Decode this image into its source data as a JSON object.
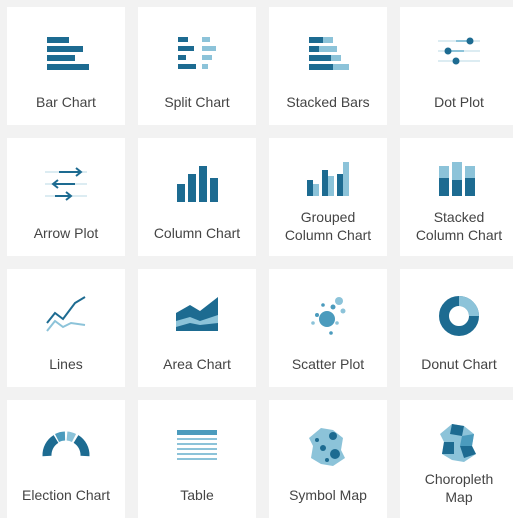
{
  "colors": {
    "primary": "#1d6b91",
    "light": "#8cc3d9",
    "mid": "#4b9bbd",
    "page": "#f2f2f2",
    "card": "#ffffff",
    "text": "#444444"
  },
  "tiles": [
    {
      "label": "Bar Chart",
      "icon": "bar-chart-icon"
    },
    {
      "label": "Split Chart",
      "icon": "split-chart-icon"
    },
    {
      "label": "Stacked Bars",
      "icon": "stacked-bars-icon"
    },
    {
      "label": "Dot Plot",
      "icon": "dot-plot-icon"
    },
    {
      "label": "Arrow Plot",
      "icon": "arrow-plot-icon"
    },
    {
      "label": "Column Chart",
      "icon": "column-chart-icon"
    },
    {
      "label": "Grouped\nColumn Chart",
      "icon": "grouped-column-chart-icon"
    },
    {
      "label": "Stacked\nColumn Chart",
      "icon": "stacked-column-chart-icon"
    },
    {
      "label": "Lines",
      "icon": "lines-icon"
    },
    {
      "label": "Area Chart",
      "icon": "area-chart-icon"
    },
    {
      "label": "Scatter Plot",
      "icon": "scatter-plot-icon"
    },
    {
      "label": "Donut Chart",
      "icon": "donut-chart-icon"
    },
    {
      "label": "Election Chart",
      "icon": "election-chart-icon"
    },
    {
      "label": "Table",
      "icon": "table-icon"
    },
    {
      "label": "Symbol Map",
      "icon": "symbol-map-icon"
    },
    {
      "label": "Choropleth\nMap",
      "icon": "choropleth-map-icon"
    }
  ]
}
